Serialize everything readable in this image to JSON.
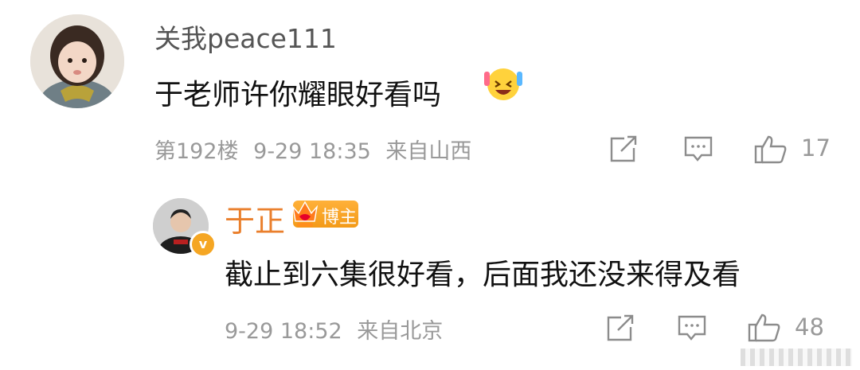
{
  "comment": {
    "username": "关我peace111",
    "text": "于老师许你耀眼好看吗",
    "floor": "第192楼",
    "time": "9-29 18:35",
    "location": "来自山西",
    "like_count": "17"
  },
  "reply": {
    "username": "于正",
    "badge_label": "博主",
    "text": "截止到六集很好看，后面我还没来得及看",
    "time": "9-29 18:52",
    "location": "来自北京",
    "like_count": "48"
  },
  "colors": {
    "username_gray": "#555555",
    "meta_gray": "#999999",
    "reply_name_orange": "#ea7f2c",
    "badge_orange": "#f5a623"
  },
  "icons": [
    "share-icon",
    "comment-icon",
    "like-icon",
    "verified-v-icon",
    "crown-icon",
    "laughing-emoji-icon"
  ]
}
